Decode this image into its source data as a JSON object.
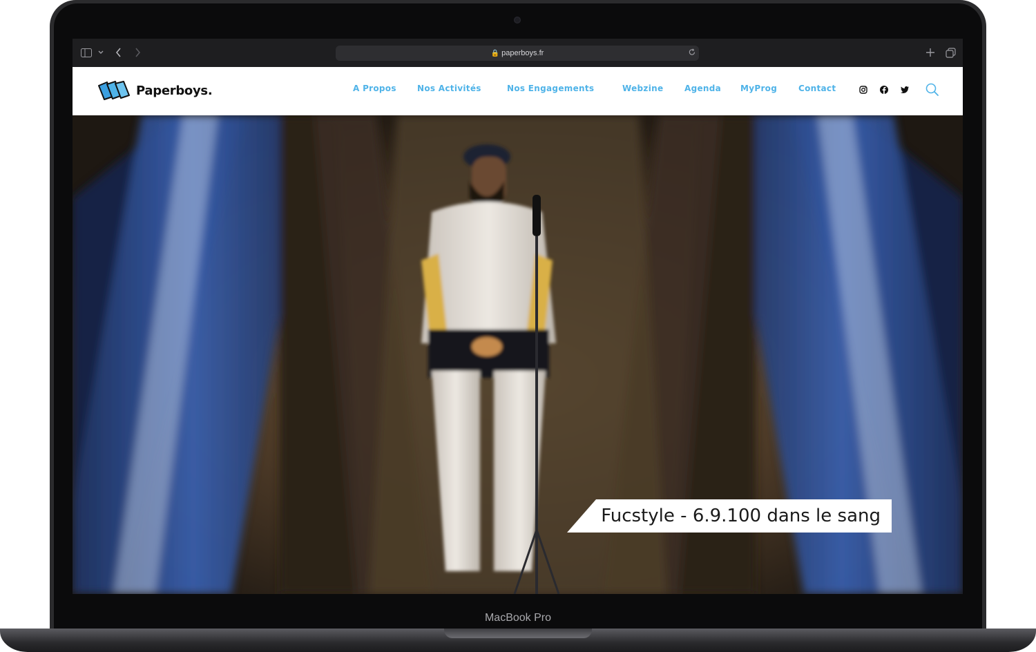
{
  "browser": {
    "url": "paperboys.fr"
  },
  "site": {
    "logo_text": "Paperboys.",
    "nav": [
      {
        "label": "A Propos"
      },
      {
        "label": "Nos Activités"
      },
      {
        "label": "Nos Engagements"
      },
      {
        "label": "Webzine"
      },
      {
        "label": "Agenda"
      },
      {
        "label": "MyProg"
      },
      {
        "label": "Contact"
      }
    ],
    "social_icons": [
      "instagram-icon",
      "facebook-icon",
      "twitter-icon"
    ],
    "accent_color": "#4fb3e8"
  },
  "hero": {
    "caption": "Fucstyle - 6.9.100 dans le sang"
  },
  "device": {
    "label": "MacBook Pro"
  }
}
